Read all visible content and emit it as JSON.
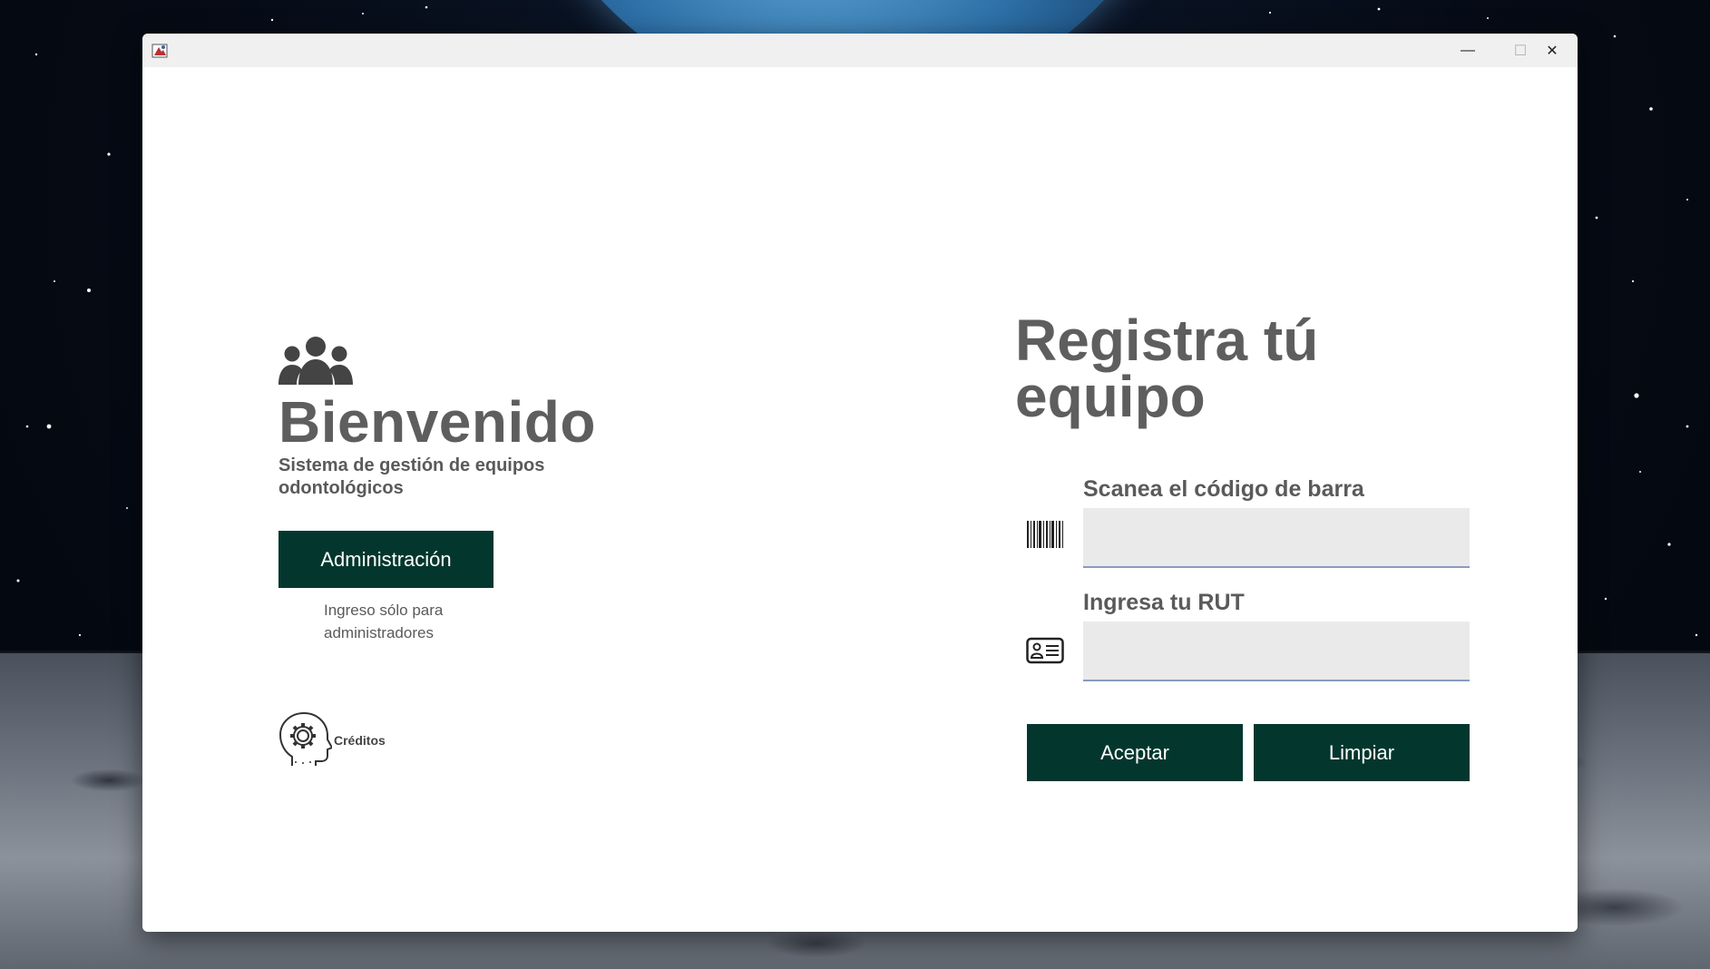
{
  "window": {
    "title": "",
    "controls": {
      "minimize": "—",
      "maximize": "☐",
      "close": "✕"
    }
  },
  "left_panel": {
    "icon": "users-group-icon",
    "title": "Bienvenido",
    "subtitle": "Sistema de gestión de equipos odontológicos",
    "admin_button_label": "Administración",
    "admin_note": "Ingreso sólo para administradores",
    "credits_icon": "head-gear-icon",
    "credits_label": "Créditos"
  },
  "right_panel": {
    "title": "Registra tú equipo",
    "barcode_field": {
      "label": "Scanea el código de barra",
      "value": "",
      "placeholder": "",
      "icon": "barcode-icon"
    },
    "rut_field": {
      "label": "Ingresa tu RUT",
      "value": "",
      "placeholder": "",
      "icon": "id-card-icon"
    },
    "accept_button_label": "Aceptar",
    "clear_button_label": "Limpiar"
  },
  "colors": {
    "button_bg": "#03372e",
    "button_text": "#ffffff",
    "heading_text": "#5e5e5e",
    "input_bg": "#eaeaea",
    "input_underline": "#8a9bbf"
  }
}
